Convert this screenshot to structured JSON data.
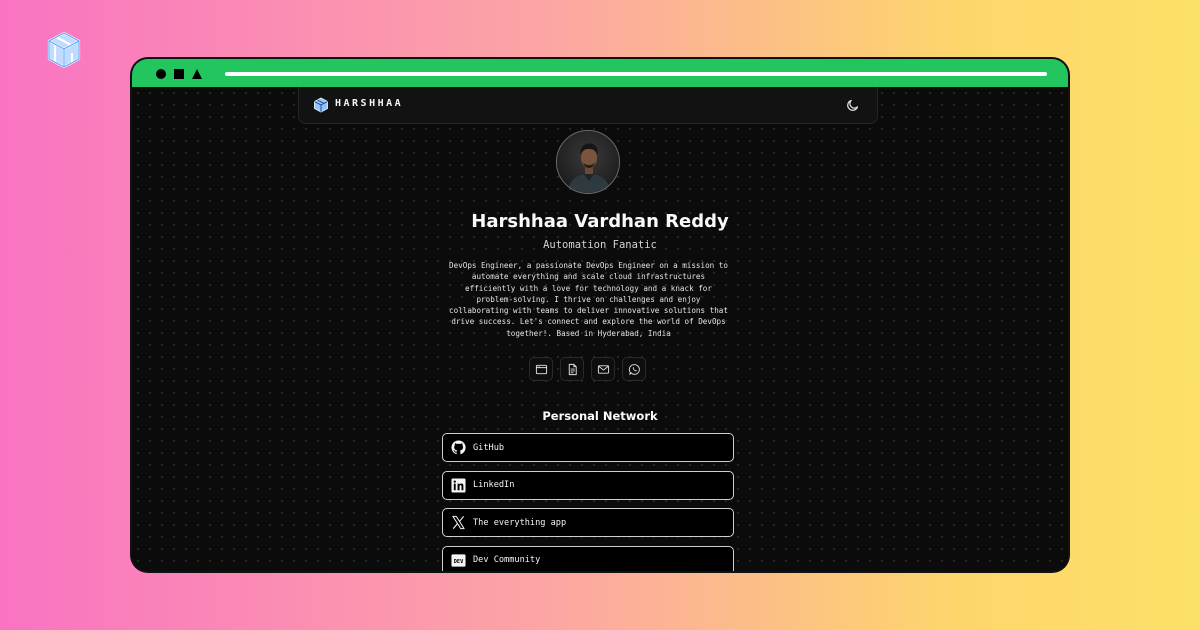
{
  "window": {
    "brand": {
      "name": "HARSHHAA"
    }
  },
  "profile": {
    "name": "Harshhaa Vardhan Reddy",
    "tagline": "Automation Fanatic",
    "bio": "DevOps Engineer, a passionate DevOps Engineer on a mission to automate everything and scale cloud infrastructures efficiently with a love for technology and a knack for problem-solving. I thrive on challenges and enjoy collaborating with teams to deliver innovative solutions that drive success. Let's connect and explore the world of DevOps together!. Based in Hyderabad, India"
  },
  "actions": [
    {
      "icon": "browser-window-icon"
    },
    {
      "icon": "document-icon"
    },
    {
      "icon": "mail-icon"
    },
    {
      "icon": "whatsapp-icon"
    }
  ],
  "network": {
    "title": "Personal Network",
    "links": [
      {
        "label": "GitHub",
        "icon": "github-icon"
      },
      {
        "label": "LinkedIn",
        "icon": "linkedin-icon"
      },
      {
        "label": "The everything app",
        "icon": "x-icon"
      },
      {
        "label": "Dev Community",
        "icon": "dev-icon"
      }
    ]
  },
  "colors": {
    "titlebar": "#22c55e",
    "page_background": "#0b0b0b",
    "gradient_start": "#f973c2",
    "gradient_end": "#fde068"
  }
}
